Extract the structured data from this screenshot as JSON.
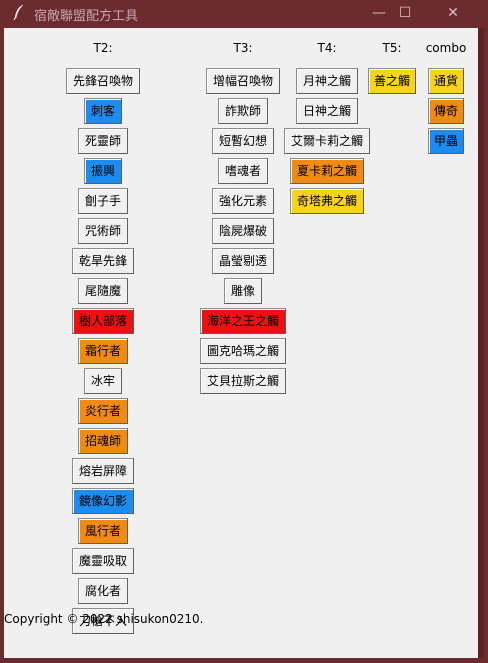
{
  "window": {
    "title": "宿敵聯盟配方工具",
    "minimize": "—",
    "maximize": "☐",
    "close": "✕"
  },
  "headers": {
    "t2": "T2:",
    "t3": "T3:",
    "t4": "T4:",
    "t5": "T5:",
    "combo": "combo"
  },
  "colors": {
    "default": "#f0f0f0",
    "blue": "#1d8cf0",
    "red": "#ee1111",
    "orange": "#f08a12",
    "yellow": "#f7d31c"
  },
  "t2": [
    {
      "label": "先鋒召喚物",
      "color": "default"
    },
    {
      "label": "刺客",
      "color": "blue"
    },
    {
      "label": "死靈師",
      "color": "default"
    },
    {
      "label": "振興",
      "color": "blue"
    },
    {
      "label": "劊子手",
      "color": "default"
    },
    {
      "label": "咒術師",
      "color": "default"
    },
    {
      "label": "乾旱先鋒",
      "color": "default"
    },
    {
      "label": "尾隨魔",
      "color": "default"
    },
    {
      "label": "樹人部落",
      "color": "red"
    },
    {
      "label": "霜行者",
      "color": "orange"
    },
    {
      "label": "冰牢",
      "color": "default"
    },
    {
      "label": "炎行者",
      "color": "orange"
    },
    {
      "label": "招魂師",
      "color": "orange"
    },
    {
      "label": "熔岩屏障",
      "color": "default"
    },
    {
      "label": "鏡像幻影",
      "color": "blue"
    },
    {
      "label": "風行者",
      "color": "orange"
    },
    {
      "label": "魔靈吸取",
      "color": "default"
    },
    {
      "label": "腐化者",
      "color": "default"
    },
    {
      "label": "刀槍不入",
      "color": "default"
    }
  ],
  "t3": [
    {
      "label": "增幅召喚物",
      "color": "default"
    },
    {
      "label": "詐欺師",
      "color": "default"
    },
    {
      "label": "短暫幻想",
      "color": "default"
    },
    {
      "label": "嗜魂者",
      "color": "default"
    },
    {
      "label": "強化元素",
      "color": "default"
    },
    {
      "label": "陰屍爆破",
      "color": "default"
    },
    {
      "label": "晶瑩剔透",
      "color": "default"
    },
    {
      "label": "雕像",
      "color": "default"
    },
    {
      "label": "海洋之王之觸",
      "color": "red"
    },
    {
      "label": "圖克哈瑪之觸",
      "color": "default"
    },
    {
      "label": "艾貝拉斯之觸",
      "color": "default"
    }
  ],
  "t4": [
    {
      "label": "月神之觸",
      "color": "default"
    },
    {
      "label": "日神之觸",
      "color": "default"
    },
    {
      "label": "艾爾卡莉之觸",
      "color": "default"
    },
    {
      "label": "夏卡莉之觸",
      "color": "orange"
    },
    {
      "label": "奇塔弗之觸",
      "color": "yellow"
    }
  ],
  "t5": [
    {
      "label": "善之觸",
      "color": "yellow"
    }
  ],
  "combo": [
    {
      "label": "通貨",
      "color": "yellow"
    },
    {
      "label": "傳奇",
      "color": "orange"
    },
    {
      "label": "甲蟲",
      "color": "blue"
    }
  ],
  "footer": "Copyright © 2022 shisukon0210."
}
